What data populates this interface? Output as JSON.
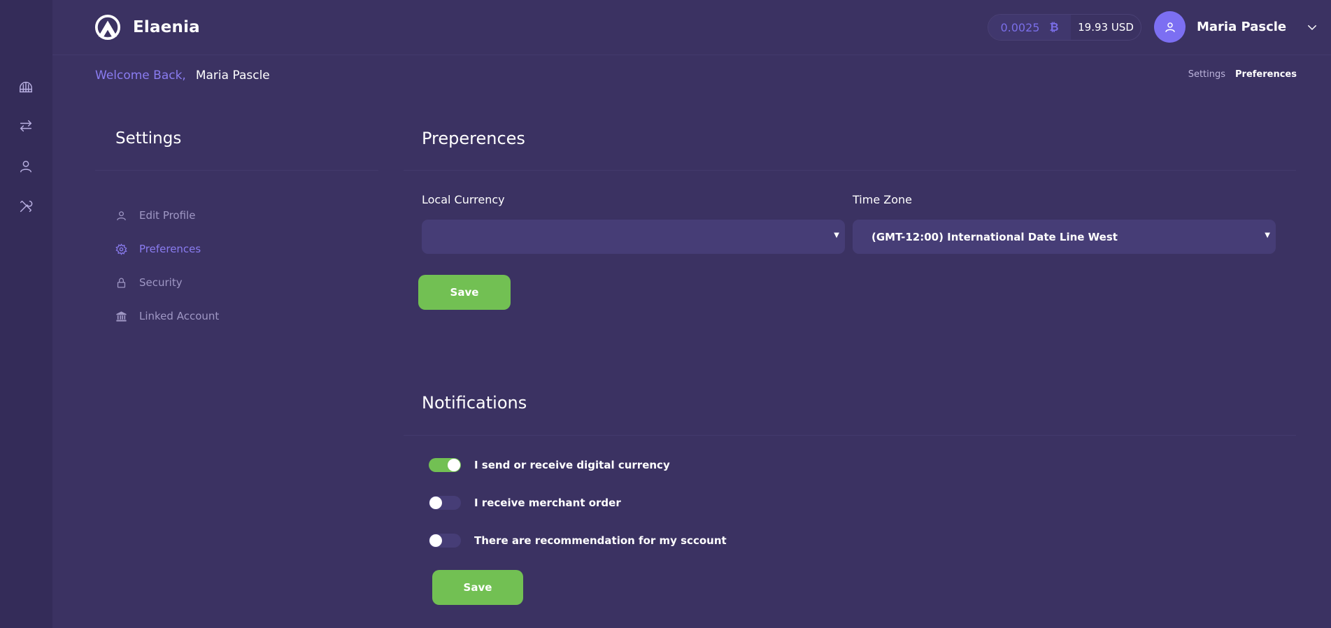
{
  "app": {
    "name": "Elaenia"
  },
  "wallet": {
    "btc_amount": "0.0025",
    "btc_symbol": "₿",
    "usd_amount": "19.93 USD"
  },
  "user": {
    "name": "Maria Pascle"
  },
  "welcome": {
    "label": "Welcome Back,",
    "name": "Maria Pascle"
  },
  "breadcrumb": [
    "Settings",
    "Preferences"
  ],
  "sidebar_nav": [
    "dashboard-icon",
    "transfer-icon",
    "user-icon",
    "tools-icon"
  ],
  "settings": {
    "title": "Settings",
    "menu": [
      {
        "label": "Edit Profile",
        "icon": "user-icon",
        "active": false
      },
      {
        "label": "Preferences",
        "icon": "gear-icon",
        "active": true
      },
      {
        "label": "Security",
        "icon": "lock-icon",
        "active": false
      },
      {
        "label": "Linked Account",
        "icon": "bank-icon",
        "active": false
      }
    ]
  },
  "preferences": {
    "title": "Preperences",
    "local_currency": {
      "label": "Local Currency",
      "value": ""
    },
    "time_zone": {
      "label": "Time Zone",
      "value": "(GMT-12:00) International Date Line West"
    },
    "save_label": "Save"
  },
  "notifications": {
    "title": "Notifications",
    "items": [
      {
        "label": "I send or receive digital currency",
        "enabled": true
      },
      {
        "label": "I receive merchant order",
        "enabled": false
      },
      {
        "label": "There are recommendation for my sccount",
        "enabled": false
      }
    ],
    "save_label": "Save"
  },
  "colors": {
    "background": "#3b3262",
    "rail": "#342c59",
    "accent": "#8a7cf0",
    "success": "#72c053",
    "input": "#463d76"
  }
}
